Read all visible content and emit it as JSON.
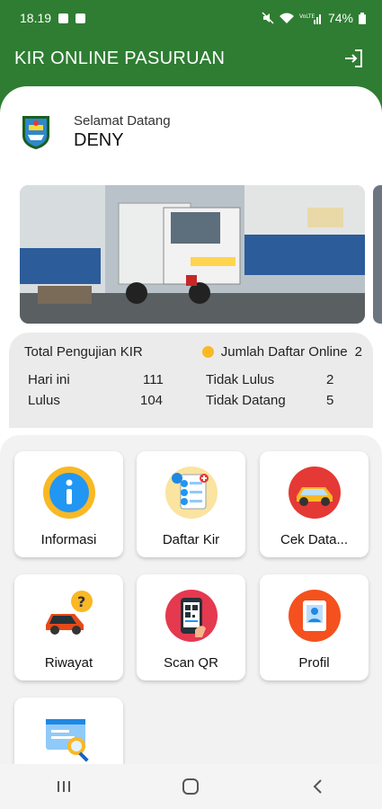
{
  "status_bar": {
    "time": "18.19",
    "battery": "74%"
  },
  "app_bar": {
    "title": "KIR ONLINE PASURUAN"
  },
  "welcome": {
    "greeting": "Selamat Datang",
    "name": "DENY"
  },
  "stats": {
    "total_label": "Total Pengujian KIR",
    "online_label": "Jumlah Daftar Online",
    "online_value": "2",
    "hari_ini_label": "Hari ini",
    "hari_ini_value": "111",
    "lulus_label": "Lulus",
    "lulus_value": "104",
    "tidak_lulus_label": "Tidak Lulus",
    "tidak_lulus_value": "2",
    "tidak_datang_label": "Tidak Datang",
    "tidak_datang_value": "5"
  },
  "menu": [
    {
      "label": "Informasi",
      "icon": "info-icon"
    },
    {
      "label": "Daftar Kir",
      "icon": "register-form-icon"
    },
    {
      "label": "Cek Data...",
      "icon": "car-check-icon"
    },
    {
      "label": "Riwayat",
      "icon": "history-car-icon"
    },
    {
      "label": "Scan QR",
      "icon": "qr-scan-icon"
    },
    {
      "label": "Profil",
      "icon": "profile-icon"
    },
    {
      "label": "",
      "icon": "monitor-search-icon"
    }
  ],
  "colors": {
    "primary": "#2e7d32",
    "accent": "#f9b824"
  }
}
